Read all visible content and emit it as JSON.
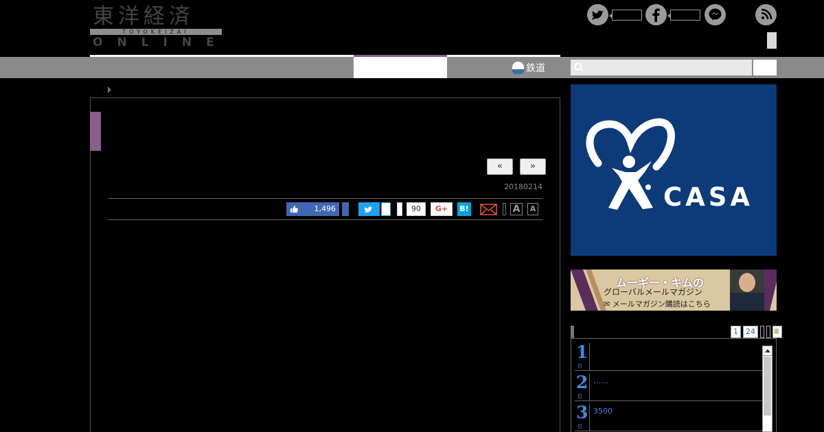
{
  "site": {
    "logo_kanji": "東洋経済",
    "logo_romaji": "TOYOKEIZAI",
    "logo_online": "ONLINE"
  },
  "nav": {
    "railway_label": "鉄道",
    "search_placeholder": ""
  },
  "article": {
    "prev_label": "«",
    "next_label": "»",
    "date": "20180214",
    "share": {
      "facebook_count": "1,496",
      "google_count": "90",
      "gplus_label": "G+",
      "hatena_label": "B!",
      "font_large": "A",
      "font_small": "A"
    },
    "paragraphs": [
      "　　　　　　　　　　　　　　　　　　　　　　　　　　　　　　　　　　　　　　　　　　　　　　　　　　　　　　　　　　　　　　　　　　　　　　　　　　　　　　　　　　　　　　　　　　　　　　　　　　　　　　　　　　　　　　　　　　　　　　　　　　　　　　　　　　　　　　"
    ]
  },
  "ads": {
    "casa_word": "CASA",
    "kim_title": "ムーギー・キムの",
    "kim_subtitle": "グローバルメールマガジン",
    "kim_cta": "メールマガジン購読はこちら"
  },
  "ranking": {
    "tabs": [
      "1",
      "24"
    ],
    "items": [
      {
        "rank": "1",
        "unit": "位",
        "text": ""
      },
      {
        "rank": "2",
        "unit": "位",
        "text": "……"
      },
      {
        "rank": "3",
        "unit": "位",
        "text": "3500"
      }
    ]
  },
  "colors": {
    "accent_purple": "#8a5d8e",
    "nav_gray": "#8a8a8a",
    "casa_blue": "#0d3b7a",
    "rank_blue": "#3b8ee0"
  }
}
